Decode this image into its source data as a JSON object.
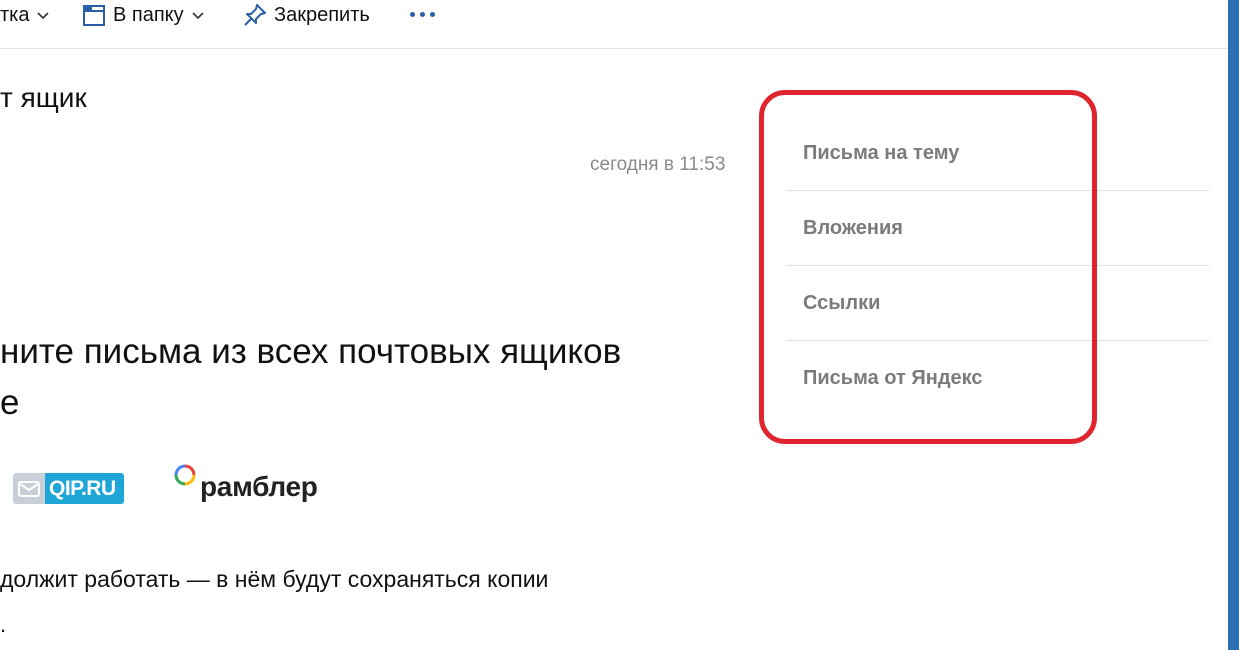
{
  "toolbar": {
    "item1_label": "тка",
    "folder_label": "В папку",
    "pin_label": "Закрепить",
    "more_icon": "more-dots-icon"
  },
  "message": {
    "subject": "т ящик",
    "timestamp": "сегодня в 11:53",
    "headline_line1": "ните письма из всех почтовых ящиков",
    "headline_line2": "е",
    "paragraph_line1": "должит работать — в нём будут сохраняться копии",
    "paragraph_line2": "."
  },
  "logos": {
    "qip_text": "QIP.RU",
    "rambler_text": "рамблер"
  },
  "side_panel": {
    "items": [
      {
        "label": "Письма на тему"
      },
      {
        "label": "Вложения"
      },
      {
        "label": "Ссылки"
      },
      {
        "label": "Письма от Яндекс"
      }
    ]
  },
  "colors": {
    "accent_blue": "#2a5ea6",
    "highlight_red": "#e0242d",
    "qip_blue": "#1fa6d8",
    "side_text_gray": "#7b7b7b"
  }
}
